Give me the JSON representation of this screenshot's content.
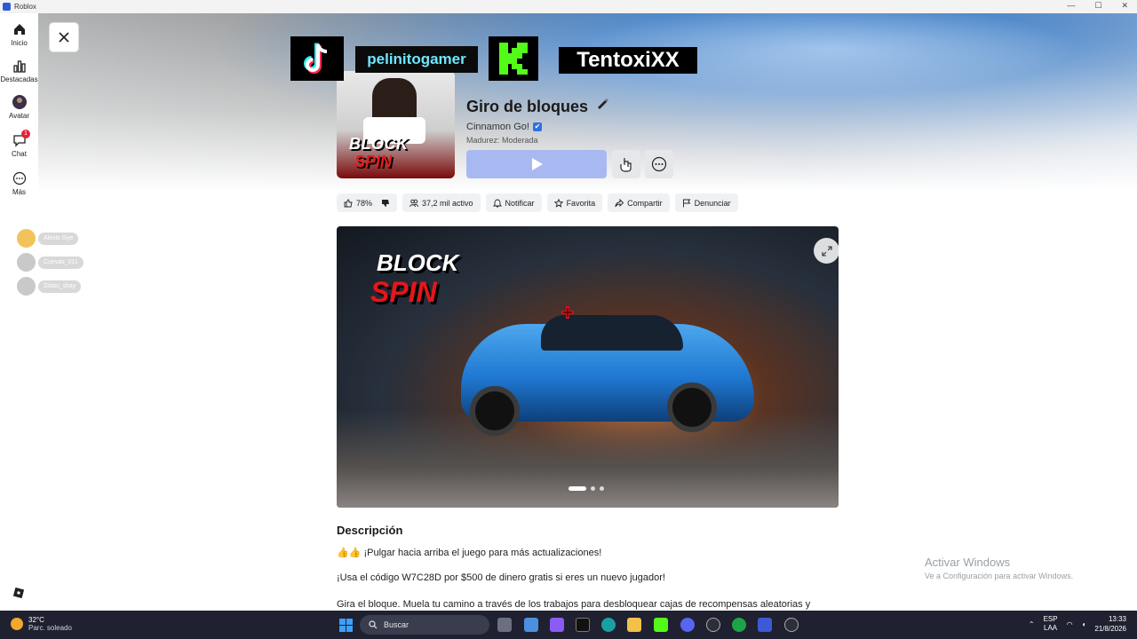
{
  "window": {
    "title": "Roblox",
    "controls": {
      "minimize": "—",
      "maximize": "☐",
      "close": "✕"
    }
  },
  "sidebar": {
    "items": [
      {
        "label": "Inicio",
        "icon": "home-icon"
      },
      {
        "label": "Destacadas",
        "icon": "charts-icon"
      },
      {
        "label": "Avatar",
        "icon": "avatar-icon"
      },
      {
        "label": "Chat",
        "icon": "chat-icon",
        "badge": "1"
      },
      {
        "label": "Más",
        "icon": "more-icon"
      }
    ],
    "friends": [
      {
        "name": "Alexis Gye"
      },
      {
        "name": "Cuevas_011"
      },
      {
        "name": "Zotau_skay"
      }
    ]
  },
  "overlay": {
    "streamer_name": "pelinitogamer",
    "kick_name": "TentoxiXX",
    "thumb_logo_top": "BLOCK",
    "thumb_logo_bottom": "SPIN"
  },
  "game": {
    "title": "Giro de bloques",
    "creator": "Cinnamon Go!",
    "verified_mark": "✔",
    "maturity": "Madurez: Moderada"
  },
  "stats": {
    "rating": "78%",
    "active": "37,2 mil activo",
    "notify": "Notificar",
    "favorite": "Favorita",
    "share": "Compartir",
    "report": "Denunciar"
  },
  "media": {
    "logo_top": "BLOCK",
    "logo_bottom": "SPIN",
    "slide_count": 3,
    "active_slide": 1
  },
  "description": {
    "title": "Descripción",
    "lines": [
      "👍👍 ¡Pulgar hacia arriba el juego para más actualizaciones!",
      "¡Usa el código W7C28D por $500 de dinero gratis si eres un nuevo jugador!",
      "Gira el bloque. Muela tu camino a través de los trabajos para desbloquear cajas de recompensas aleatorias y"
    ]
  },
  "watermark": {
    "line1": "Activar Windows",
    "line2": "Ve a Configuración para activar Windows."
  },
  "taskbar": {
    "weather_temp": "32°C",
    "weather_desc": "Parc. soleado",
    "search_placeholder": "Buscar",
    "lang_top": "ESP",
    "lang_bottom": "LAA",
    "time": "13:33",
    "date": "21/8/2026"
  },
  "colors": {
    "accent_play": "#a8b9f2",
    "chip_bg": "#f0f1f3",
    "taskbar_bg": "#1f2130",
    "badge_red": "#e0223a"
  }
}
